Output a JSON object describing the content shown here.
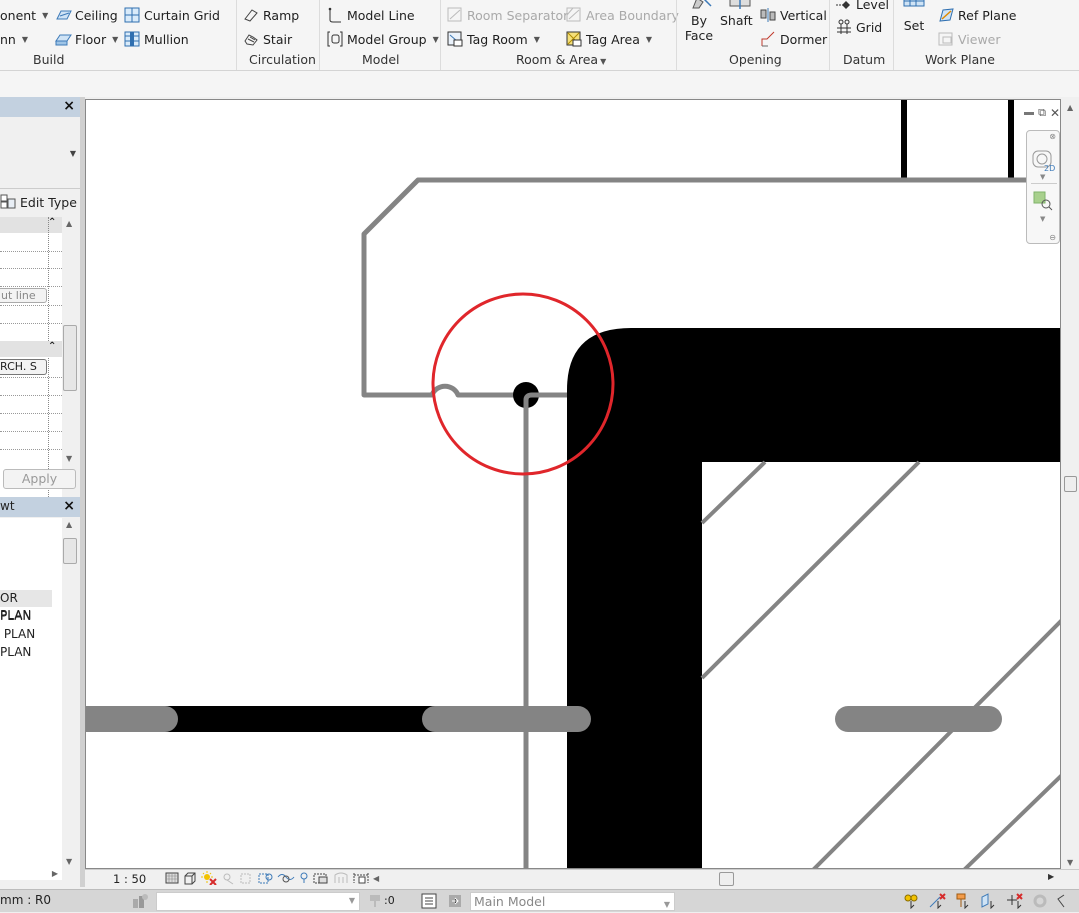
{
  "ribbon": {
    "build": {
      "label": "Build",
      "items": [
        {
          "label": "onent",
          "icon": "component-icon",
          "dropdown": true
        },
        {
          "label": "nn",
          "icon": "column-icon",
          "dropdown": true
        },
        {
          "label": "Ceiling",
          "icon": "ceiling-icon"
        },
        {
          "label": "Floor",
          "icon": "floor-icon",
          "dropdown": true
        },
        {
          "label": "Curtain  Grid",
          "icon": "curtain-grid-icon"
        },
        {
          "label": "Mullion",
          "icon": "mullion-icon"
        }
      ]
    },
    "circulation": {
      "label": "Circulation",
      "items": [
        {
          "label": "Ramp",
          "icon": "ramp-icon"
        },
        {
          "label": "Stair",
          "icon": "stair-icon"
        }
      ]
    },
    "model": {
      "label": "Model",
      "items": [
        {
          "label": "Model  Line",
          "icon": "model-line-icon"
        },
        {
          "label": "Model  Group",
          "icon": "model-group-icon",
          "dropdown": true
        }
      ]
    },
    "room_area": {
      "label": "Room & Area",
      "items": [
        {
          "label": "Room  Separator",
          "icon": "room-separator-icon",
          "disabled": true
        },
        {
          "label": "Area  Boundary",
          "icon": "area-boundary-icon",
          "disabled": true
        },
        {
          "label": "Tag  Room",
          "icon": "tag-room-icon",
          "dropdown": true
        },
        {
          "label": "Tag  Area",
          "icon": "tag-area-icon",
          "dropdown": true
        }
      ]
    },
    "opening": {
      "label": "Opening",
      "items": [
        {
          "label": "By",
          "label2": "Face",
          "icon": "by-face-icon"
        },
        {
          "label": "Shaft",
          "icon": "shaft-icon"
        },
        {
          "label": "Vertical",
          "icon": "vertical-icon"
        },
        {
          "label": "Dormer",
          "icon": "dormer-icon"
        }
      ]
    },
    "datum": {
      "label": "Datum",
      "items": [
        {
          "label": "Level",
          "icon": "level-icon"
        },
        {
          "label": "Grid",
          "icon": "grid-icon"
        }
      ]
    },
    "work_plane": {
      "label": "Work Plane",
      "items": [
        {
          "label": "Set",
          "icon": "set-icon"
        },
        {
          "label": "Ref  Plane",
          "icon": "ref-plane-icon"
        },
        {
          "label": "Viewer",
          "icon": "viewer-icon",
          "disabled": true
        }
      ]
    }
  },
  "properties": {
    "close": "×",
    "edit_type": "Edit Type",
    "field_cut_line": "ut line",
    "field_arch": "RCH. S",
    "apply": "Apply"
  },
  "project_browser": {
    "title": "wt",
    "close": "×",
    "items": [
      "OR PLAN",
      "PLAN",
      " PLAN",
      "PLAN"
    ]
  },
  "view_controls": {
    "scale": "1 : 50"
  },
  "status_bar": {
    "left_text": "mm : R0",
    "workset_value": "",
    "editing_count": ":0",
    "design_option": "Main Model"
  },
  "colors": {
    "highlight_circle": "#e0262b",
    "wall_fill": "#000000",
    "line_gray": "#848484"
  }
}
